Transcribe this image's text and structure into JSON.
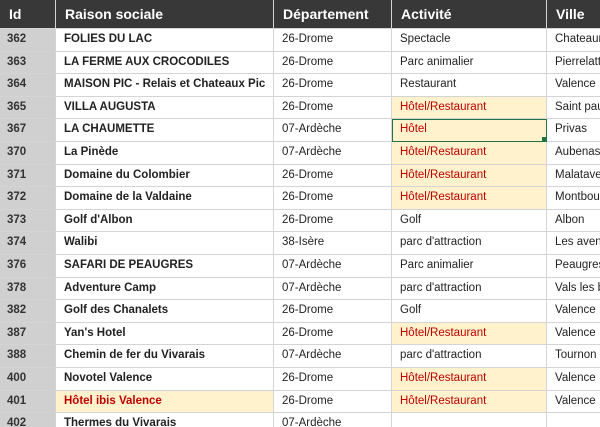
{
  "columns": {
    "id": "Id",
    "raison": "Raison sociale",
    "departement": "Département",
    "activite": "Activité",
    "ville": "Ville"
  },
  "rows": [
    {
      "id": "362",
      "raison": "FOLIES DU LAC",
      "departement": "26-Drome",
      "activite": "Spectacle",
      "ville": "Chateaun"
    },
    {
      "id": "363",
      "raison": "LA FERME AUX CROCODILES",
      "departement": "26-Drome",
      "activite": "Parc animalier",
      "ville": "Pierrelatt"
    },
    {
      "id": "364",
      "raison": "MAISON PIC - Relais et Chateaux Pic",
      "departement": "26-Drome",
      "activite": "Restaurant",
      "ville": "Valence"
    },
    {
      "id": "365",
      "raison": "VILLA AUGUSTA",
      "departement": "26-Drome",
      "activite": "Hôtel/Restaurant",
      "ville": "Saint paul"
    },
    {
      "id": "367",
      "raison": "LA CHAUMETTE",
      "departement": "07-Ardèche",
      "activite": "Hôtel",
      "ville": "Privas"
    },
    {
      "id": "370",
      "raison": "La Pinède",
      "departement": "07-Ardèche",
      "activite": "Hôtel/Restaurant",
      "ville": "Aubenas"
    },
    {
      "id": "371",
      "raison": "Domaine du Colombier",
      "departement": "26-Drome",
      "activite": "Hôtel/Restaurant",
      "ville": "Malataver"
    },
    {
      "id": "372",
      "raison": "Domaine de la Valdaine",
      "departement": "26-Drome",
      "activite": "Hôtel/Restaurant",
      "ville": "Montbou"
    },
    {
      "id": "373",
      "raison": "Golf d'Albon",
      "departement": "26-Drome",
      "activite": "Golf",
      "ville": "Albon"
    },
    {
      "id": "374",
      "raison": "Walibi",
      "departement": "38-Isère",
      "activite": "parc d'attraction",
      "ville": "Les aveni"
    },
    {
      "id": "376",
      "raison": "SAFARI DE PEAUGRES",
      "departement": "07-Ardèche",
      "activite": "Parc animalier",
      "ville": "Peaugres"
    },
    {
      "id": "378",
      "raison": "Adventure Camp",
      "departement": "07-Ardèche",
      "activite": "parc d'attraction",
      "ville": "Vals les b"
    },
    {
      "id": "382",
      "raison": "Golf des Chanalets",
      "departement": "26-Drome",
      "activite": "Golf",
      "ville": "Valence"
    },
    {
      "id": "387",
      "raison": "Yan's Hotel",
      "departement": "26-Drome",
      "activite": "Hôtel/Restaurant",
      "ville": "Valence"
    },
    {
      "id": "388",
      "raison": "Chemin de fer du Vivarais",
      "departement": "07-Ardèche",
      "activite": "parc d'attraction",
      "ville": "Tournon s"
    },
    {
      "id": "400",
      "raison": "Novotel Valence",
      "departement": "26-Drome",
      "activite": "Hôtel/Restaurant",
      "ville": "Valence"
    },
    {
      "id": "401",
      "raison": "Hôtel ibis Valence",
      "departement": "26-Drome",
      "activite": "Hôtel/Restaurant",
      "ville": "Valence"
    },
    {
      "id": "402",
      "raison": "Thermes du Vivarais",
      "departement": "07-Ardèche",
      "activite": "",
      "ville": ""
    }
  ],
  "colors": {
    "header_bg": "#383838",
    "highlight_bg": "#fff2cc",
    "highlight_text": "#c00000",
    "selection": "#217346"
  }
}
